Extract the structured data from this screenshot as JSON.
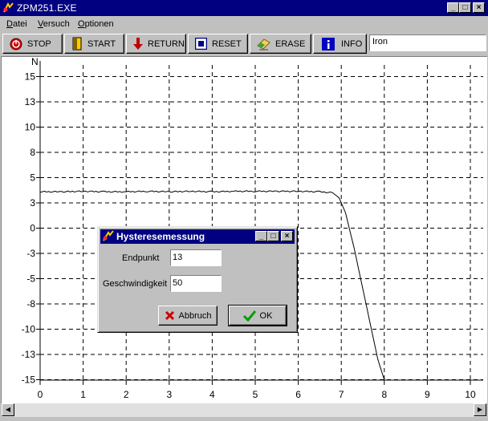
{
  "window": {
    "title": "ZPM251.EXE"
  },
  "menu": {
    "items": [
      "Datei",
      "Versuch",
      "Optionen"
    ]
  },
  "toolbar": {
    "buttons": [
      {
        "label": "STOP",
        "icon": "stop-icon"
      },
      {
        "label": "START",
        "icon": "start-icon"
      },
      {
        "label": "RETURN",
        "icon": "return-arrow-icon"
      },
      {
        "label": "RESET",
        "icon": "reset-icon"
      },
      {
        "label": "ERASE",
        "icon": "erase-icon"
      },
      {
        "label": "INFO",
        "icon": "info-icon"
      }
    ],
    "material": "Iron"
  },
  "chart_data": {
    "type": "line",
    "ylabel": "N",
    "xlabel": "",
    "xlim": [
      0,
      10
    ],
    "ylim": [
      -15,
      16
    ],
    "x_ticks": [
      0,
      1,
      2,
      3,
      4,
      5,
      6,
      7,
      8,
      9,
      10
    ],
    "x_tick_labels": [
      "0",
      "1",
      "2",
      "3",
      "4",
      "5",
      "6",
      "7",
      "8",
      "9",
      "10"
    ],
    "y_ticks": [
      15,
      12.5,
      10,
      7.5,
      5,
      2.5,
      0,
      -2.5,
      -5,
      -7.5,
      -10,
      -12.5,
      -15
    ],
    "y_tick_labels": [
      "15",
      "13",
      "10",
      "8",
      "5",
      "3",
      "0",
      "-3",
      "-5",
      "-8",
      "-10",
      "-13",
      "-15"
    ],
    "grid": true,
    "series": [
      {
        "color": "#000000",
        "x": [
          0,
          0.5,
          1,
          1.5,
          2,
          2.5,
          3,
          3.5,
          4,
          4.5,
          5,
          5.5,
          6,
          6.5,
          6.8,
          6.95,
          7.1,
          7.3,
          7.5,
          7.7,
          7.85,
          8.0
        ],
        "y": [
          3.6,
          3.6,
          3.65,
          3.6,
          3.6,
          3.65,
          3.6,
          3.65,
          3.6,
          3.65,
          3.65,
          3.65,
          3.65,
          3.6,
          3.5,
          3.0,
          1.5,
          -2.0,
          -6.0,
          -10.0,
          -13.0,
          -15.0
        ]
      }
    ]
  },
  "dialog": {
    "title": "Hysteresemessung",
    "fields": [
      {
        "label": "Endpunkt",
        "value": "13"
      },
      {
        "label": "Geschwindigkeit",
        "value": "50"
      }
    ],
    "cancel_label": "Abbruch",
    "ok_label": "OK"
  }
}
